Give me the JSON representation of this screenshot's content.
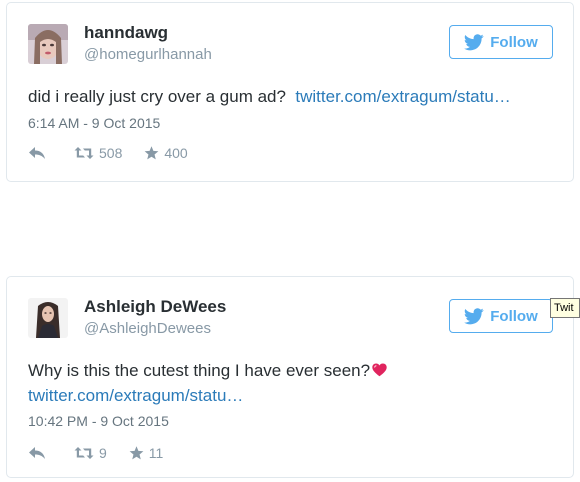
{
  "colors": {
    "accent": "#55acee",
    "link": "#2b7bb9",
    "text": "#292f33",
    "muted": "#8899a6",
    "border": "#e1e8ed",
    "heart": "#e0245e"
  },
  "tweets": [
    {
      "display_name": "hanndawg",
      "handle": "@homegurlhannah",
      "follow_label": "Follow",
      "text": "did i really just cry over a gum ad?",
      "link": "twitter.com/extragum/statu…",
      "timestamp": "6:14 AM - 9 Oct 2015",
      "retweets": "508",
      "likes": "400"
    },
    {
      "display_name": "Ashleigh DeWees",
      "handle": "@AshleighDewees",
      "follow_label": "Follow",
      "text": "Why is this the cutest thing I have ever seen?",
      "link": "twitter.com/extragum/statu…",
      "timestamp": "10:42 PM - 9 Oct 2015",
      "retweets": "9",
      "likes": "11"
    }
  ],
  "icons": {
    "follow": "twitter-bird-icon",
    "reply": "reply-arrow-icon",
    "retweet": "retweet-icon",
    "like": "star-icon",
    "emoji": "heart-emoji-icon"
  },
  "tooltip": {
    "text": "Twit"
  }
}
